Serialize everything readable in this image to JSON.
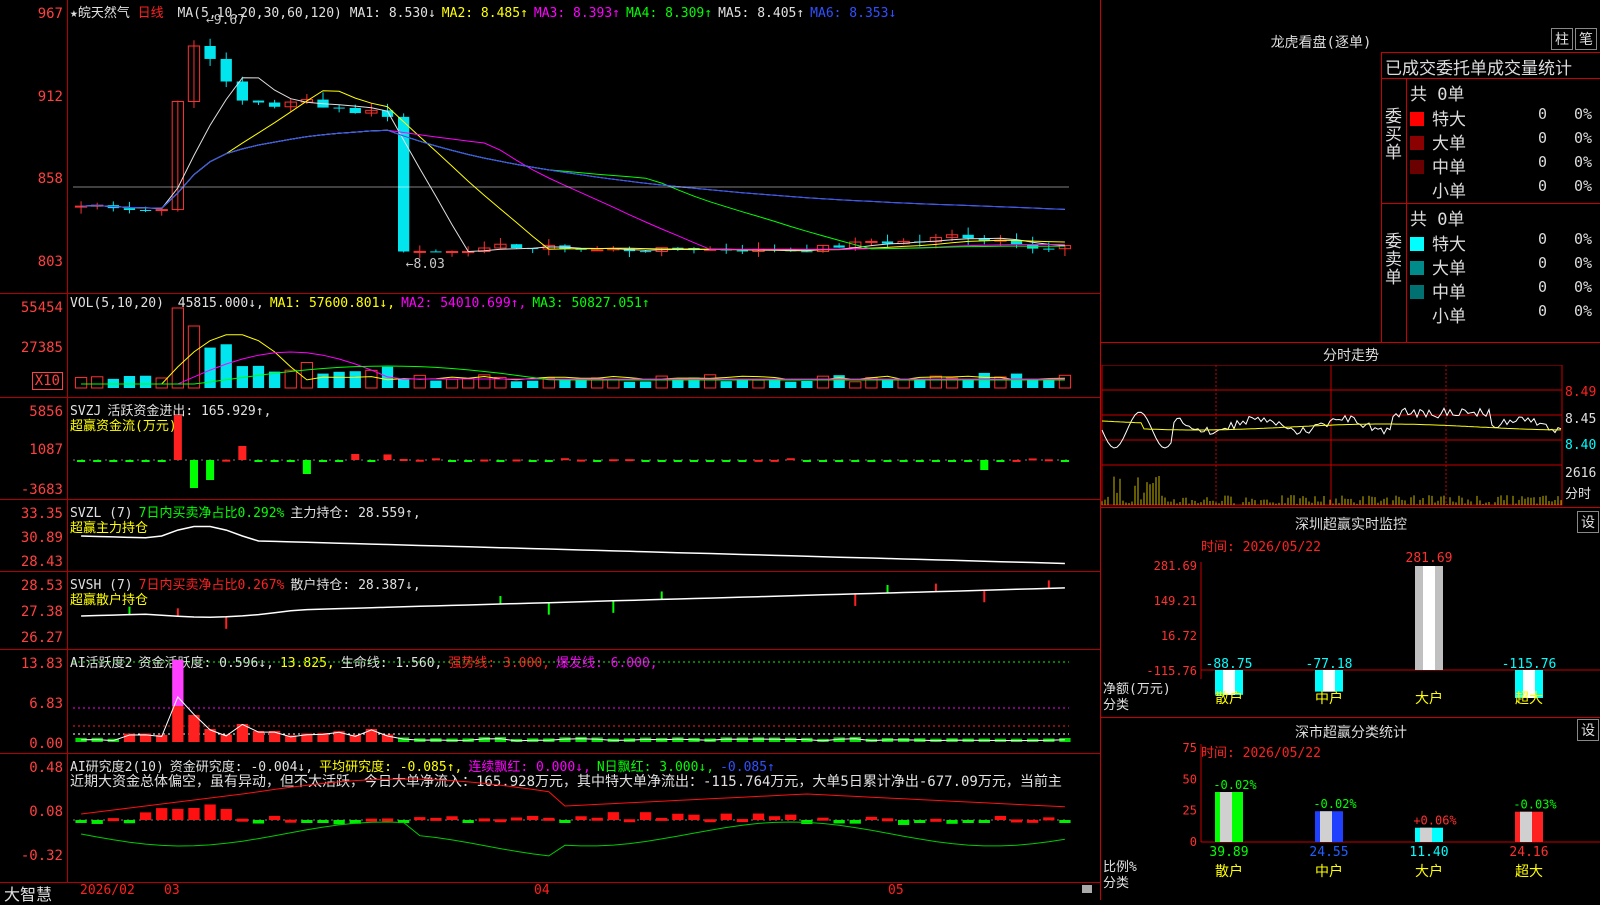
{
  "stock": {
    "name": "★皖天然气",
    "period": "日线"
  },
  "main": {
    "ticks": [
      "967",
      "912",
      "858",
      "803"
    ],
    "ma_label": "MA(5,10,20,30,60,120)",
    "ma": [
      {
        "text": "MA1: 8.530↓",
        "color": "#e0e0e0"
      },
      {
        "text": "MA2: 8.485↑",
        "color": "#ffff00"
      },
      {
        "text": "MA3: 8.393↑",
        "color": "#ff00ff"
      },
      {
        "text": "MA4: 8.309↑",
        "color": "#00ff00"
      },
      {
        "text": "MA5: 8.405↑",
        "color": "#e0e0e0"
      },
      {
        "text": "MA6: 8.353↓",
        "color": "#3050ff"
      }
    ],
    "high_label": "9.67",
    "low_label": "8.03"
  },
  "vol": {
    "ticks": [
      "55454",
      "27385"
    ],
    "unit": "X10",
    "label": "VOL(5,10,20)",
    "items": [
      {
        "text": "45815.000↓,",
        "color": "#e0e0e0"
      },
      {
        "text": "MA1: 57600.801↓,",
        "color": "#ffff00"
      },
      {
        "text": "MA2: 54010.699↑,",
        "color": "#ff00ff"
      },
      {
        "text": "MA3: 50827.051↑",
        "color": "#00ff00"
      }
    ]
  },
  "svzj": {
    "ticks": [
      "5856",
      "1087",
      "-3683"
    ],
    "line1": [
      {
        "text": "SVZJ",
        "color": "#e0e0e0"
      },
      {
        "text": "活跃资金进出: 165.929↑,",
        "color": "#e0e0e0"
      }
    ],
    "line2": "超赢资金流(万元)"
  },
  "svzl": {
    "ticks": [
      "33.35",
      "30.89",
      "28.43"
    ],
    "line1": [
      {
        "text": "SVZL (7)",
        "color": "#e0e0e0"
      },
      {
        "text": "7日内买卖净占比0.292%",
        "color": "#00ff00"
      },
      {
        "text": "主力持仓: 28.559↑,",
        "color": "#e0e0e0"
      }
    ],
    "line2": "超赢主力持仓"
  },
  "svsh": {
    "ticks": [
      "28.53",
      "27.38",
      "26.27"
    ],
    "line1": [
      {
        "text": "SVSH (7)",
        "color": "#e0e0e0"
      },
      {
        "text": "7日内买卖净占比0.267%",
        "color": "#ff2020"
      },
      {
        "text": "散户持仓: 28.387↓,",
        "color": "#e0e0e0"
      }
    ],
    "line2": "超赢散户持仓"
  },
  "ai1": {
    "ticks": [
      "13.83",
      "6.83",
      "0.00"
    ],
    "line1": [
      {
        "text": "AI活跃度2",
        "color": "#e0e0e0"
      },
      {
        "text": "资金活跃度: 0.596↓,",
        "color": "#e0e0e0"
      },
      {
        "text": "13.825,",
        "color": "#ffff00"
      },
      {
        "text": "生命线: 1.560,",
        "color": "#e0e0e0"
      },
      {
        "text": "强势线: 3.000,",
        "color": "#ff2020"
      },
      {
        "text": "爆发线: 6.000,",
        "color": "#ff00ff"
      }
    ]
  },
  "ai2": {
    "ticks": [
      "0.48",
      "0.08",
      "-0.32"
    ],
    "line1": [
      {
        "text": "AI研究度2(10)",
        "color": "#e0e0e0"
      },
      {
        "text": "资金研究度: -0.004↓,",
        "color": "#e0e0e0"
      },
      {
        "text": "平均研究度: -0.085↑,",
        "color": "#ffff00"
      },
      {
        "text": "连续飘红: 0.000↓,",
        "color": "#ff00ff"
      },
      {
        "text": "N日飘红: 3.000↓,",
        "color": "#00ff00"
      },
      {
        "text": "-0.085↑",
        "color": "#3050ff"
      }
    ],
    "comment": "近期大资金总体偏空，虽有异动，但不太活跃，今日大单净流入：165.928万元，其中特大单净流出：-115.764万元，大单5日累计净出-677.09万元，当前主"
  },
  "bottom": {
    "brand": "大智慧",
    "dates": [
      "2026/02",
      "03",
      "04",
      "05"
    ]
  },
  "lhb": {
    "title": "龙虎看盘(逐单)",
    "btn1": "柱",
    "btn2": "笔",
    "subtitle": "已成交委托单成交量统计",
    "buy_label": "委买单",
    "sell_label": "委卖单",
    "buy_total": "共 0单",
    "sell_total": "共 0单",
    "buy_rows": [
      {
        "label": "特大",
        "count": "0",
        "pct": "0%",
        "color": "#ff0000"
      },
      {
        "label": "大单",
        "count": "0",
        "pct": "0%",
        "color": "#8b0000"
      },
      {
        "label": "中单",
        "count": "0",
        "pct": "0%",
        "color": "#6a0000"
      },
      {
        "label": "小单",
        "count": "0",
        "pct": "0%",
        "color": ""
      }
    ],
    "sell_rows": [
      {
        "label": "特大",
        "count": "0",
        "pct": "0%",
        "color": "#00ffff"
      },
      {
        "label": "大单",
        "count": "0",
        "pct": "0%",
        "color": "#008b8b"
      },
      {
        "label": "中单",
        "count": "0",
        "pct": "0%",
        "color": "#007070"
      },
      {
        "label": "小单",
        "count": "0",
        "pct": "0%",
        "color": ""
      }
    ]
  },
  "fenshi": {
    "title": "分时走势",
    "ticks": [
      "8.49",
      "8.45",
      "8.40"
    ],
    "vol_ticks": [
      "2616",
      "分时"
    ]
  },
  "monitor": {
    "title": "深圳超赢实时监控",
    "btn": "设",
    "time": "时间: 2026/05/22",
    "ticks": [
      "281.69",
      "149.21",
      "16.72",
      "-115.76"
    ],
    "ylabel": "净额(万元)",
    "xlabel": "分类",
    "categories": [
      "散户",
      "中户",
      "大户",
      "超大"
    ],
    "values": [
      -88.75,
      -77.18,
      281.69,
      -115.76
    ],
    "labels": [
      "-88.75",
      "-77.18",
      "281.69",
      "-115.76"
    ]
  },
  "classify": {
    "title": "深市超赢分类统计",
    "btn": "设",
    "time": "时间: 2026/05/22",
    "ticks": [
      "75",
      "50",
      "25",
      "0"
    ],
    "ylabel": "比例%",
    "xlabel": "分类",
    "categories": [
      "散户",
      "中户",
      "大户",
      "超大"
    ],
    "values": [
      39.89,
      24.55,
      11.4,
      24.16
    ],
    "changes": [
      "-0.02%",
      "-0.02%",
      "+0.06%",
      "-0.03%"
    ],
    "value_labels": [
      "39.89",
      "24.55",
      "11.40",
      "24.16"
    ]
  }
}
